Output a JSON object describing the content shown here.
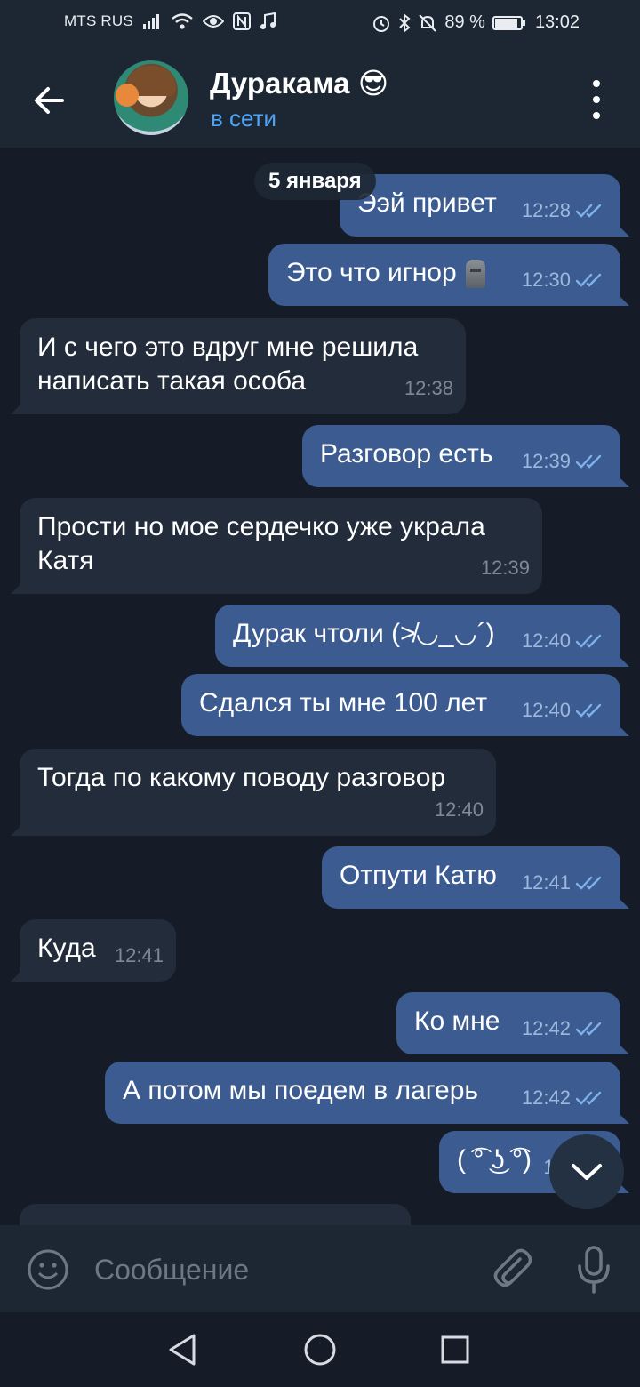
{
  "status_bar": {
    "carrier": "MTS RUS",
    "battery": "89 %",
    "battery_level": 0.89,
    "time": "13:02"
  },
  "header": {
    "contact_name": "Дуракама 😎",
    "contact_status": "в сети"
  },
  "chat": {
    "date_label": "5 января",
    "messages": [
      {
        "direction": "out",
        "text": "Ээй привет",
        "time": "12:28",
        "read": true
      },
      {
        "direction": "out",
        "text": "Это что игнор",
        "time": "12:30",
        "read": true,
        "trailing_icon": "moai-icon"
      },
      {
        "direction": "in",
        "text": "И с чего это вдруг мне решила\nнаписать такая особа",
        "time": "12:38"
      },
      {
        "direction": "out",
        "text": "Разговор есть",
        "time": "12:39",
        "read": true
      },
      {
        "direction": "in",
        "text": "Прости но мое сердечко уже украла\nКатя",
        "time": "12:39"
      },
      {
        "direction": "out",
        "text": "Дурак чтоли (≯◡_◡´)",
        "time": "12:40",
        "read": true
      },
      {
        "direction": "out",
        "text": "Сдался ты мне 100 лет",
        "time": "12:40",
        "read": true
      },
      {
        "direction": "in",
        "text": "Тогда по какому поводу разговор",
        "time": "12:40"
      },
      {
        "direction": "out",
        "text": "Отпути Катю",
        "time": "12:41",
        "read": true
      },
      {
        "direction": "in",
        "text": "Куда",
        "time": "12:41"
      },
      {
        "direction": "out",
        "text": "Ко мне",
        "time": "12:42",
        "read": true
      },
      {
        "direction": "out",
        "text": "А потом мы поедем в лагерь",
        "time": "12:42",
        "read": true
      },
      {
        "direction": "out",
        "text": "( ͡° ͜ʖ ͡°)",
        "time": "12:",
        "read": true
      }
    ]
  },
  "input": {
    "placeholder": "Сообщение"
  },
  "colors": {
    "background": "#151c27",
    "header": "#1d2733",
    "outgoing_bubble": "#3c5c91",
    "incoming_bubble": "#222c3a",
    "accent": "#4ea4f6"
  }
}
